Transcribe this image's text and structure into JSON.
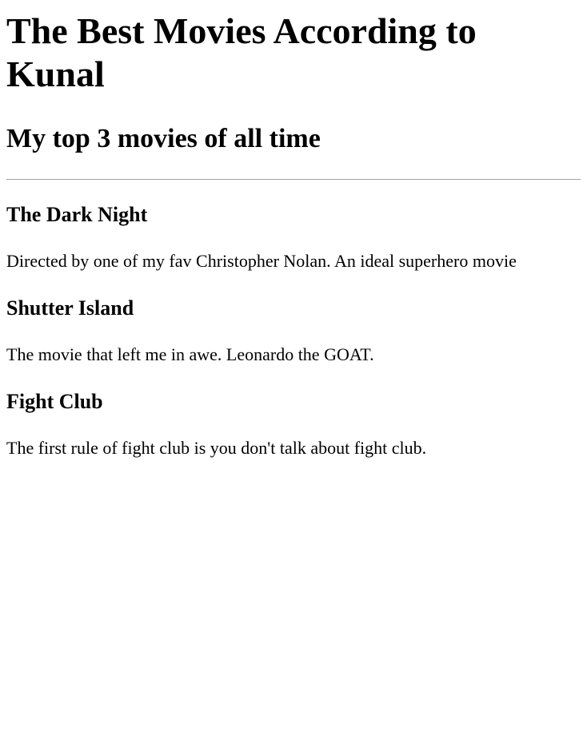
{
  "page": {
    "title": "The Best Movies According to Kunal",
    "subtitle": "My top 3 movies of all time"
  },
  "movies": [
    {
      "title": "The Dark Night",
      "description": "Directed by one of my fav Christopher Nolan. An ideal superhero movie"
    },
    {
      "title": "Shutter Island",
      "description": "The movie that left me in awe. Leonardo the GOAT."
    },
    {
      "title": "Fight Club",
      "description": "The first rule of fight club is you don't talk about fight club."
    }
  ]
}
